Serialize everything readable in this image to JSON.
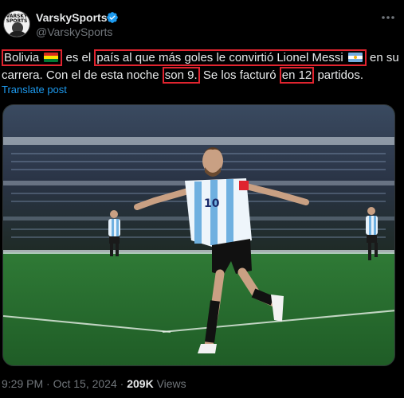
{
  "author": {
    "display_name": "VarskySports",
    "handle": "@VarskySports",
    "avatar_text": "VARSKY SPORTS",
    "verified": true
  },
  "tweet": {
    "segments": [
      {
        "text": "Bolivia",
        "highlight": true,
        "flag": "bolivia-flag"
      },
      {
        "text": " es el ",
        "highlight": false
      },
      {
        "text": "país al que más goles le convirtió Lionel Messi",
        "highlight": true,
        "flag": "argentina-flag"
      },
      {
        "text": " en su carrera. Con el de esta noche ",
        "highlight": false
      },
      {
        "text": "son 9.",
        "highlight": true
      },
      {
        "text": " Se los facturó ",
        "highlight": false
      },
      {
        "text": "en 12",
        "highlight": true
      },
      {
        "text": " partidos.",
        "highlight": false
      }
    ],
    "translate_label": "Translate post"
  },
  "media": {
    "description_icon": "soccer-player-celebration-photo",
    "jersey_number": "10"
  },
  "meta": {
    "time": "9:29 PM",
    "separator": " · ",
    "date": "Oct 15, 2024",
    "views_count": "209K",
    "views_label": "Views"
  },
  "colors": {
    "background": "#000000",
    "text": "#e7e9ea",
    "secondary": "#71767b",
    "link": "#1d9bf0",
    "highlight_box": "#e0242f",
    "verified": "#1d9bf0"
  }
}
